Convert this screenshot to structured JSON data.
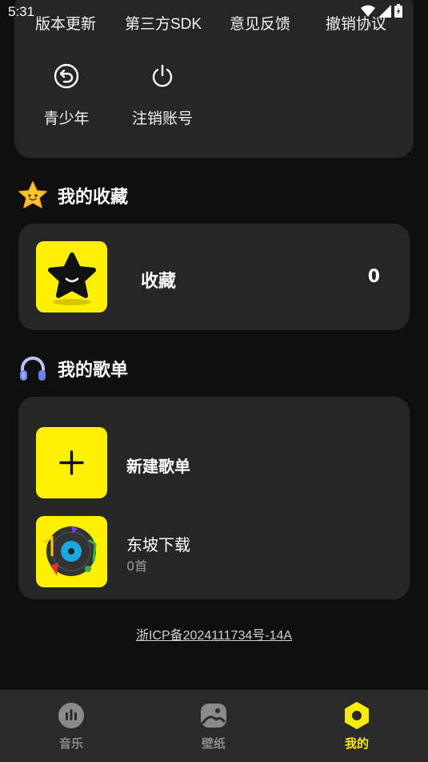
{
  "status": {
    "time": "5:31"
  },
  "top_links": [
    "版本更新",
    "第三方SDK",
    "意见反馈",
    "撤销协议"
  ],
  "tiles": [
    {
      "label": "青少年",
      "icon": "undo-circle-icon"
    },
    {
      "label": "注销账号",
      "icon": "power-icon"
    }
  ],
  "favorites": {
    "section_title": "我的收藏",
    "section_icon": "star-emoji-icon",
    "item_label": "收藏",
    "item_count": "0"
  },
  "playlists": {
    "section_title": "我的歌单",
    "section_icon": "headphones-icon",
    "new_label": "新建歌单",
    "items": [
      {
        "name": "东坡下载",
        "count": "0首"
      }
    ]
  },
  "icp": "浙ICP备2024111734号-14A",
  "nav": [
    {
      "label": "音乐",
      "icon": "music-icon"
    },
    {
      "label": "壁纸",
      "icon": "wallpaper-icon"
    },
    {
      "label": "我的",
      "icon": "profile-icon"
    }
  ],
  "colors": {
    "accent": "#fcec00",
    "card": "#262626",
    "background": "#0f0f0f"
  }
}
